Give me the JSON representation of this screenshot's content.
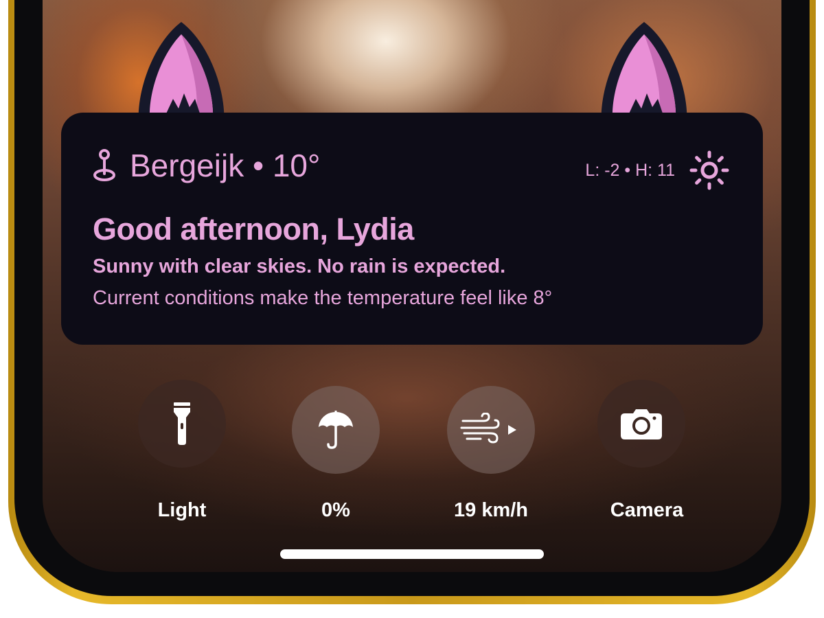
{
  "weather": {
    "location_line": "Bergeijk • 10°",
    "low_high": "L: -2 • H: 11",
    "greeting": "Good afternoon, Lydia",
    "summary": "Sunny with clear skies. No rain is expected.",
    "feels_like": "Current conditions make the temperature feel like 8°",
    "location_icon": "location-pin-icon",
    "condition_icon": "sun-icon"
  },
  "controls": [
    {
      "label": "Light",
      "icon": "flashlight-icon"
    },
    {
      "label": "0%",
      "icon": "umbrella-icon"
    },
    {
      "label": "19 km/h",
      "icon": "wind-icon"
    },
    {
      "label": "Camera",
      "icon": "camera-icon"
    }
  ],
  "colors": {
    "accent_pink": "#e7a6dc",
    "widget_bg": "#0d0c17",
    "frame_gold": "#d4a520"
  }
}
